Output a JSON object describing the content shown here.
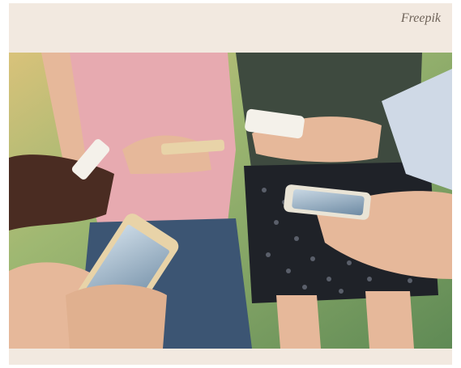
{
  "credit": "Freepik",
  "photo": {
    "subject_icon": "group-using-smartphones-photo",
    "palette": {
      "frame": "#f2e9e0",
      "grass": "#7fa36a",
      "pink_top": "#e7aab0",
      "dark_top": "#3e4a3f",
      "shorts": "#1f2228",
      "jeans": "#3c5573",
      "skin_light": "#e6b89a",
      "skin_dark": "#4a2c22",
      "phone_white": "#f4f1ea",
      "phone_gold": "#e8d3a8",
      "phone_screen": "#9fb6c8"
    }
  }
}
